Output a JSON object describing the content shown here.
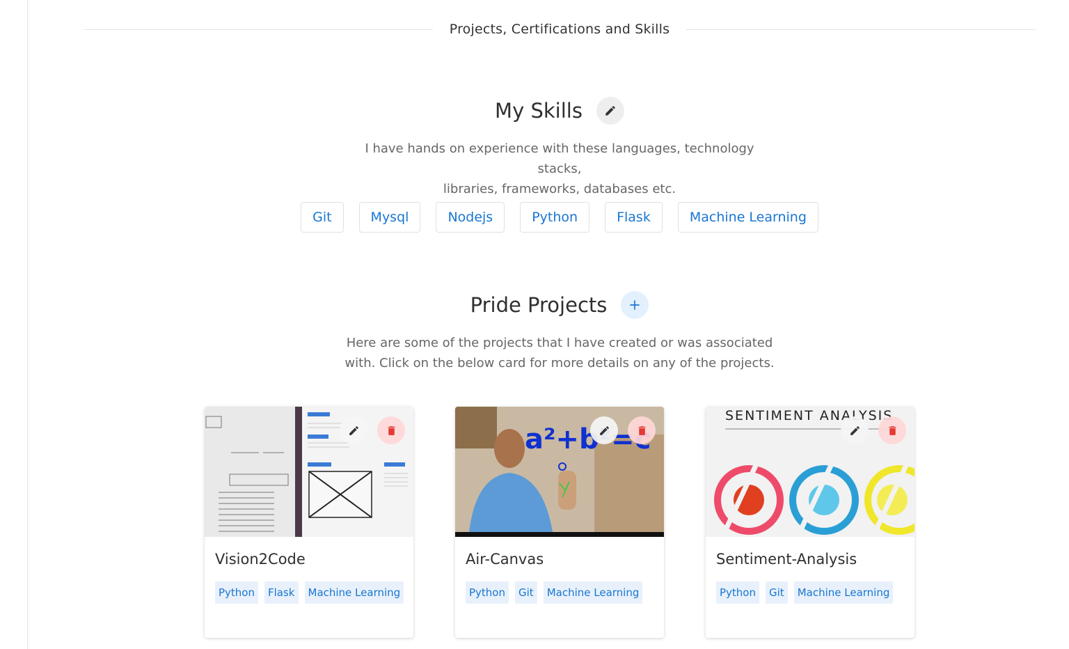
{
  "divider": {
    "label": "Projects, Certifications and Skills"
  },
  "skills_section": {
    "title": "My Skills",
    "description_line1": "I have hands on experience with these languages, technology stacks,",
    "description_line2": "libraries, frameworks, databases etc.",
    "skills": [
      "Git",
      "Mysql",
      "Nodejs",
      "Python",
      "Flask",
      "Machine Learning"
    ]
  },
  "projects_section": {
    "title": "Pride Projects",
    "add_icon": "plus-icon",
    "description_line1": "Here are some of the projects that I have created or was associated",
    "description_line2": "with. Click on the below card for more details on any of the projects.",
    "projects": [
      {
        "title": "Vision2Code",
        "tags": [
          "Python",
          "Flask",
          "Machine Learning"
        ]
      },
      {
        "title": "Air-Canvas",
        "tags": [
          "Python",
          "Git",
          "Machine Learning"
        ]
      },
      {
        "title": "Sentiment-Analysis",
        "tags": [
          "Python",
          "Git",
          "Machine Learning"
        ],
        "thumbnail_text": "SENTIMENT ANALYSIS"
      }
    ]
  },
  "icons": {
    "edit": "pencil-icon",
    "delete": "trash-icon"
  },
  "colors": {
    "accent": "#1976d2",
    "delete": "#e53935",
    "chip_bg": "#e8f1fb"
  }
}
